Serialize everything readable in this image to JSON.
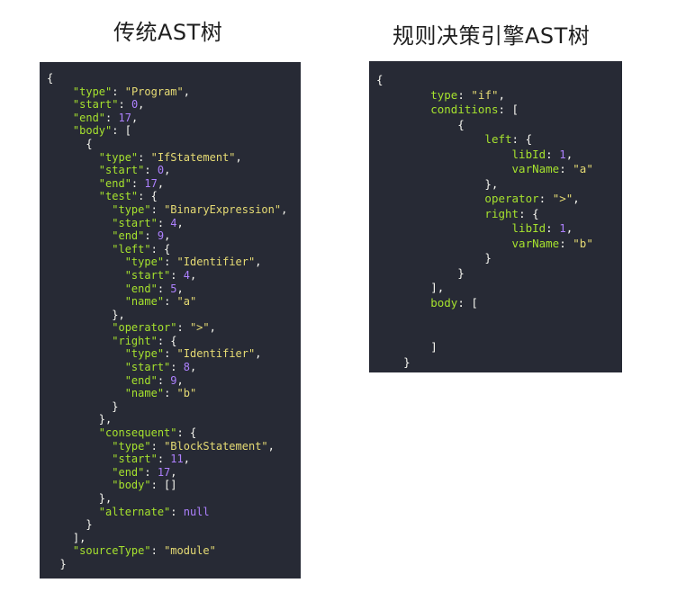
{
  "titles": {
    "left": "传统AST树",
    "right": "规则决策引擎AST树"
  },
  "colors": {
    "panel_bg": "#272a35",
    "key": "#a6e22e",
    "string": "#e6db74",
    "number": "#ae81ff",
    "punct": "#f8f8f2"
  },
  "left_code": [
    [
      [
        "{",
        "punct"
      ]
    ],
    [
      [
        "    ",
        "punct"
      ],
      [
        "\"type\"",
        "key"
      ],
      [
        ": ",
        "punct"
      ],
      [
        "\"Program\"",
        "str"
      ],
      [
        ",",
        "punct"
      ]
    ],
    [
      [
        "    ",
        "punct"
      ],
      [
        "\"start\"",
        "key"
      ],
      [
        ": ",
        "punct"
      ],
      [
        "0",
        "num"
      ],
      [
        ",",
        "punct"
      ]
    ],
    [
      [
        "    ",
        "punct"
      ],
      [
        "\"end\"",
        "key"
      ],
      [
        ": ",
        "punct"
      ],
      [
        "17",
        "num"
      ],
      [
        ",",
        "punct"
      ]
    ],
    [
      [
        "    ",
        "punct"
      ],
      [
        "\"body\"",
        "key"
      ],
      [
        ": [",
        "punct"
      ]
    ],
    [
      [
        "      {",
        "punct"
      ]
    ],
    [
      [
        "        ",
        "punct"
      ],
      [
        "\"type\"",
        "key"
      ],
      [
        ": ",
        "punct"
      ],
      [
        "\"IfStatement\"",
        "str"
      ],
      [
        ",",
        "punct"
      ]
    ],
    [
      [
        "        ",
        "punct"
      ],
      [
        "\"start\"",
        "key"
      ],
      [
        ": ",
        "punct"
      ],
      [
        "0",
        "num"
      ],
      [
        ",",
        "punct"
      ]
    ],
    [
      [
        "        ",
        "punct"
      ],
      [
        "\"end\"",
        "key"
      ],
      [
        ": ",
        "punct"
      ],
      [
        "17",
        "num"
      ],
      [
        ",",
        "punct"
      ]
    ],
    [
      [
        "        ",
        "punct"
      ],
      [
        "\"test\"",
        "key"
      ],
      [
        ": {",
        "punct"
      ]
    ],
    [
      [
        "          ",
        "punct"
      ],
      [
        "\"type\"",
        "key"
      ],
      [
        ": ",
        "punct"
      ],
      [
        "\"BinaryExpression\"",
        "str"
      ],
      [
        ",",
        "punct"
      ]
    ],
    [
      [
        "          ",
        "punct"
      ],
      [
        "\"start\"",
        "key"
      ],
      [
        ": ",
        "punct"
      ],
      [
        "4",
        "num"
      ],
      [
        ",",
        "punct"
      ]
    ],
    [
      [
        "          ",
        "punct"
      ],
      [
        "\"end\"",
        "key"
      ],
      [
        ": ",
        "punct"
      ],
      [
        "9",
        "num"
      ],
      [
        ",",
        "punct"
      ]
    ],
    [
      [
        "          ",
        "punct"
      ],
      [
        "\"left\"",
        "key"
      ],
      [
        ": {",
        "punct"
      ]
    ],
    [
      [
        "            ",
        "punct"
      ],
      [
        "\"type\"",
        "key"
      ],
      [
        ": ",
        "punct"
      ],
      [
        "\"Identifier\"",
        "str"
      ],
      [
        ",",
        "punct"
      ]
    ],
    [
      [
        "            ",
        "punct"
      ],
      [
        "\"start\"",
        "key"
      ],
      [
        ": ",
        "punct"
      ],
      [
        "4",
        "num"
      ],
      [
        ",",
        "punct"
      ]
    ],
    [
      [
        "            ",
        "punct"
      ],
      [
        "\"end\"",
        "key"
      ],
      [
        ": ",
        "punct"
      ],
      [
        "5",
        "num"
      ],
      [
        ",",
        "punct"
      ]
    ],
    [
      [
        "            ",
        "punct"
      ],
      [
        "\"name\"",
        "key"
      ],
      [
        ": ",
        "punct"
      ],
      [
        "\"a\"",
        "str"
      ]
    ],
    [
      [
        "          },",
        "punct"
      ]
    ],
    [
      [
        "          ",
        "punct"
      ],
      [
        "\"operator\"",
        "key"
      ],
      [
        ": ",
        "punct"
      ],
      [
        "\">\"",
        "str"
      ],
      [
        ",",
        "punct"
      ]
    ],
    [
      [
        "          ",
        "punct"
      ],
      [
        "\"right\"",
        "key"
      ],
      [
        ": {",
        "punct"
      ]
    ],
    [
      [
        "            ",
        "punct"
      ],
      [
        "\"type\"",
        "key"
      ],
      [
        ": ",
        "punct"
      ],
      [
        "\"Identifier\"",
        "str"
      ],
      [
        ",",
        "punct"
      ]
    ],
    [
      [
        "            ",
        "punct"
      ],
      [
        "\"start\"",
        "key"
      ],
      [
        ": ",
        "punct"
      ],
      [
        "8",
        "num"
      ],
      [
        ",",
        "punct"
      ]
    ],
    [
      [
        "            ",
        "punct"
      ],
      [
        "\"end\"",
        "key"
      ],
      [
        ": ",
        "punct"
      ],
      [
        "9",
        "num"
      ],
      [
        ",",
        "punct"
      ]
    ],
    [
      [
        "            ",
        "punct"
      ],
      [
        "\"name\"",
        "key"
      ],
      [
        ": ",
        "punct"
      ],
      [
        "\"b\"",
        "str"
      ]
    ],
    [
      [
        "          }",
        "punct"
      ]
    ],
    [
      [
        "        },",
        "punct"
      ]
    ],
    [
      [
        "        ",
        "punct"
      ],
      [
        "\"consequent\"",
        "key"
      ],
      [
        ": {",
        "punct"
      ]
    ],
    [
      [
        "          ",
        "punct"
      ],
      [
        "\"type\"",
        "key"
      ],
      [
        ": ",
        "punct"
      ],
      [
        "\"BlockStatement\"",
        "str"
      ],
      [
        ",",
        "punct"
      ]
    ],
    [
      [
        "          ",
        "punct"
      ],
      [
        "\"start\"",
        "key"
      ],
      [
        ": ",
        "punct"
      ],
      [
        "11",
        "num"
      ],
      [
        ",",
        "punct"
      ]
    ],
    [
      [
        "          ",
        "punct"
      ],
      [
        "\"end\"",
        "key"
      ],
      [
        ": ",
        "punct"
      ],
      [
        "17",
        "num"
      ],
      [
        ",",
        "punct"
      ]
    ],
    [
      [
        "          ",
        "punct"
      ],
      [
        "\"body\"",
        "key"
      ],
      [
        ": []",
        "punct"
      ]
    ],
    [
      [
        "        },",
        "punct"
      ]
    ],
    [
      [
        "        ",
        "punct"
      ],
      [
        "\"alternate\"",
        "key"
      ],
      [
        ": ",
        "punct"
      ],
      [
        "null",
        "null"
      ]
    ],
    [
      [
        "      }",
        "punct"
      ]
    ],
    [
      [
        "    ],",
        "punct"
      ]
    ],
    [
      [
        "    ",
        "punct"
      ],
      [
        "\"sourceType\"",
        "key"
      ],
      [
        ": ",
        "punct"
      ],
      [
        "\"module\"",
        "str"
      ]
    ],
    [
      [
        "  }",
        "punct"
      ]
    ]
  ],
  "right_code": [
    [
      [
        "{",
        "punct"
      ]
    ],
    [
      [
        "        ",
        "punct"
      ],
      [
        "type",
        "key"
      ],
      [
        ": ",
        "punct"
      ],
      [
        "\"if\"",
        "str"
      ],
      [
        ",",
        "punct"
      ]
    ],
    [
      [
        "        ",
        "punct"
      ],
      [
        "conditions",
        "key"
      ],
      [
        ": [",
        "punct"
      ]
    ],
    [
      [
        "            {",
        "punct"
      ]
    ],
    [
      [
        "                ",
        "punct"
      ],
      [
        "left",
        "key"
      ],
      [
        ": {",
        "punct"
      ]
    ],
    [
      [
        "                    ",
        "punct"
      ],
      [
        "libId",
        "key"
      ],
      [
        ": ",
        "punct"
      ],
      [
        "1",
        "num"
      ],
      [
        ",",
        "punct"
      ]
    ],
    [
      [
        "                    ",
        "punct"
      ],
      [
        "varName",
        "key"
      ],
      [
        ": ",
        "punct"
      ],
      [
        "\"a\"",
        "str"
      ]
    ],
    [
      [
        "                },",
        "punct"
      ]
    ],
    [
      [
        "                ",
        "punct"
      ],
      [
        "operator",
        "key"
      ],
      [
        ": ",
        "punct"
      ],
      [
        "\">\"",
        "str"
      ],
      [
        ",",
        "punct"
      ]
    ],
    [
      [
        "                ",
        "punct"
      ],
      [
        "right",
        "key"
      ],
      [
        ": {",
        "punct"
      ]
    ],
    [
      [
        "                    ",
        "punct"
      ],
      [
        "libId",
        "key"
      ],
      [
        ": ",
        "punct"
      ],
      [
        "1",
        "num"
      ],
      [
        ",",
        "punct"
      ]
    ],
    [
      [
        "                    ",
        "punct"
      ],
      [
        "varName",
        "key"
      ],
      [
        ": ",
        "punct"
      ],
      [
        "\"b\"",
        "str"
      ]
    ],
    [
      [
        "                }",
        "punct"
      ]
    ],
    [
      [
        "            }",
        "punct"
      ]
    ],
    [
      [
        "        ],",
        "punct"
      ]
    ],
    [
      [
        "        ",
        "punct"
      ],
      [
        "body",
        "key"
      ],
      [
        ": [",
        "punct"
      ]
    ],
    [
      [
        "",
        "punct"
      ]
    ],
    [
      [
        "",
        "punct"
      ]
    ],
    [
      [
        "        ]",
        "punct"
      ]
    ],
    [
      [
        "    }",
        "punct"
      ]
    ]
  ]
}
